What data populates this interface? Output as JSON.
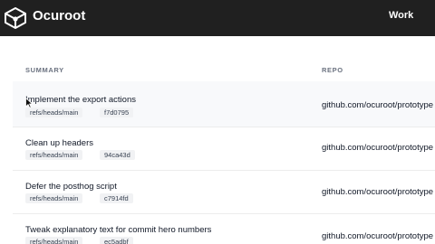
{
  "header": {
    "brand": "Ocuroot",
    "nav_work": "Work"
  },
  "table": {
    "columns": {
      "summary": "SUMMARY",
      "repo": "REPO"
    },
    "rows": [
      {
        "title": "Implement the export actions",
        "ref": "refs/heads/main",
        "commit": "f7d0795",
        "repo": "github.com/ocuroot/prototype"
      },
      {
        "title": "Clean up headers",
        "ref": "refs/heads/main",
        "commit": "94ca43d",
        "repo": "github.com/ocuroot/prototype"
      },
      {
        "title": "Defer the posthog script",
        "ref": "refs/heads/main",
        "commit": "c7914fd",
        "repo": "github.com/ocuroot/prototype"
      },
      {
        "title": "Tweak explanatory text for commit hero numbers",
        "ref": "refs/heads/main",
        "commit": "ec5adbf",
        "repo": "github.com/ocuroot/prototype"
      }
    ]
  },
  "colors": {
    "topbar": "#202020",
    "row_hover": "#f8f9fb",
    "tag_bg": "#f1f2f4"
  },
  "icons": {
    "logo": "ocuroot-cube-logo-icon",
    "cursor": "mouse-pointer-icon"
  }
}
